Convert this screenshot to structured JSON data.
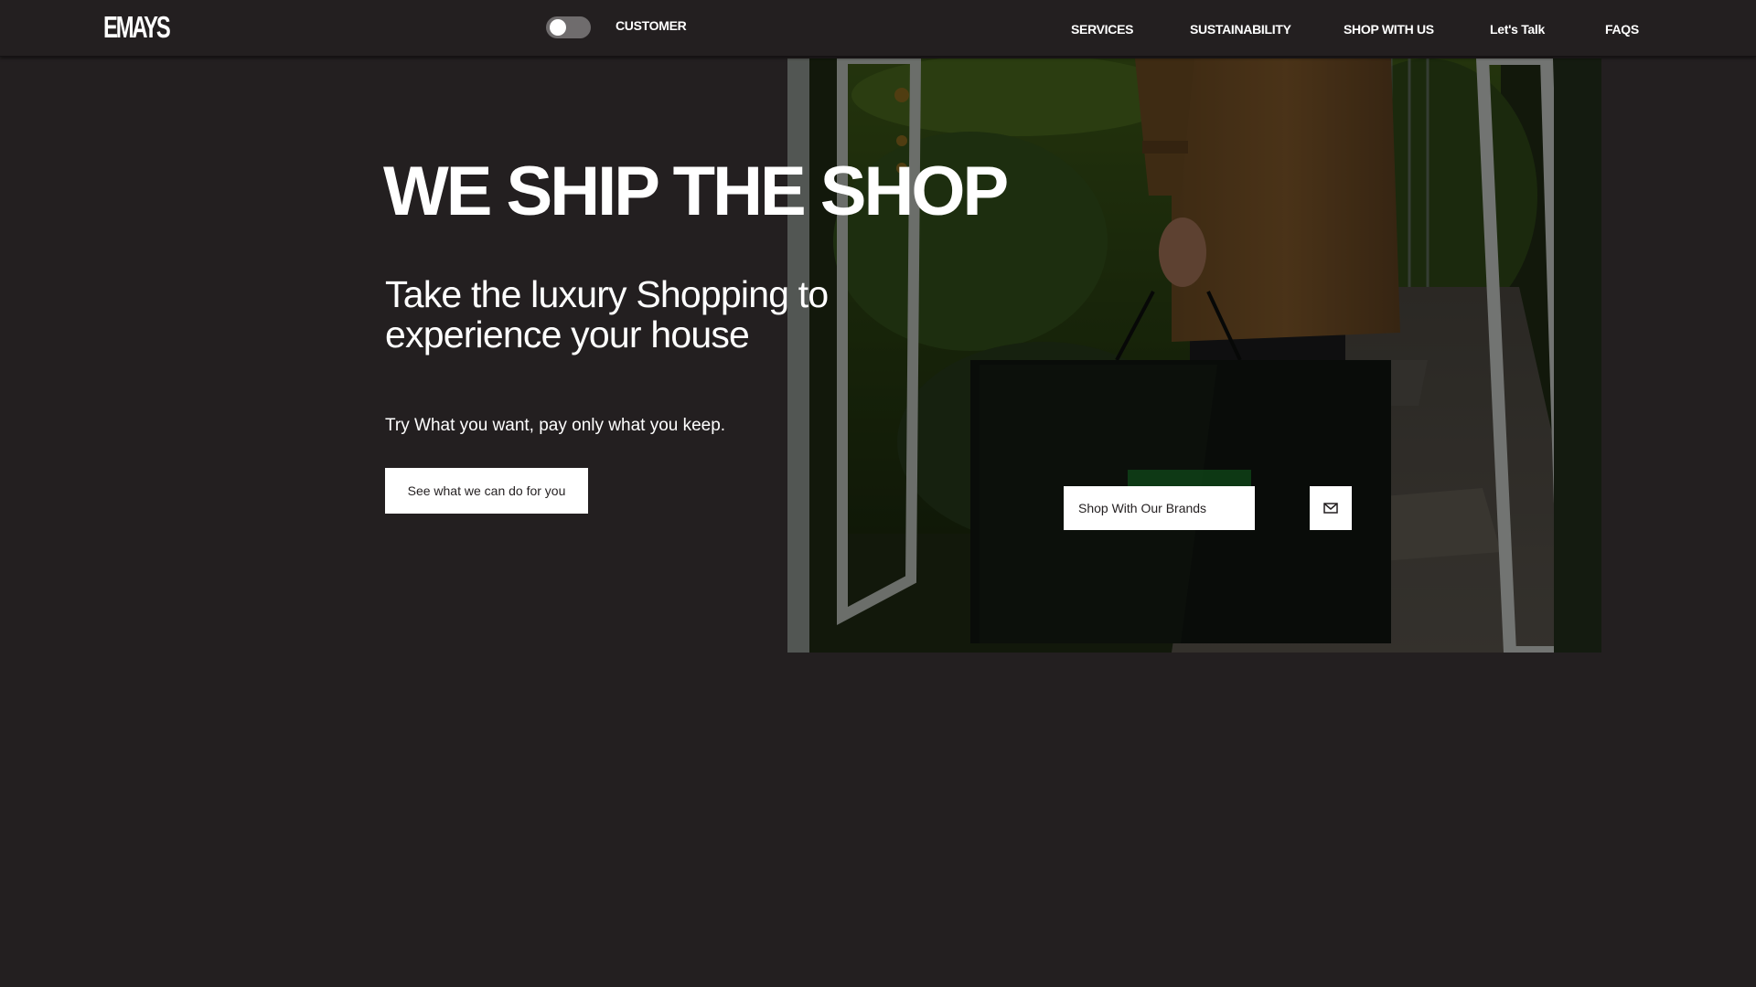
{
  "brand": {
    "logo": "EMAYS"
  },
  "mode_toggle": {
    "label": "CUSTOMER"
  },
  "nav": {
    "items": [
      {
        "label": "SERVICES"
      },
      {
        "label": "SUSTAINABILITY"
      },
      {
        "label": "SHOP WITH US"
      },
      {
        "label": "Let's Talk"
      },
      {
        "label": "FAQS"
      }
    ]
  },
  "hero": {
    "headline": "WE SHIP THE SHOP",
    "subheadline": "Take the luxury Shopping to experience your house",
    "tagline": "Try What you want, pay only what you keep.",
    "cta_label": "See what we can do for you",
    "shop_brands_label": "Shop With Our Brands",
    "mail_icon": "mail-icon"
  },
  "colors": {
    "background": "#231f20",
    "button_bg": "#ffffff",
    "button_text": "#231f20"
  }
}
